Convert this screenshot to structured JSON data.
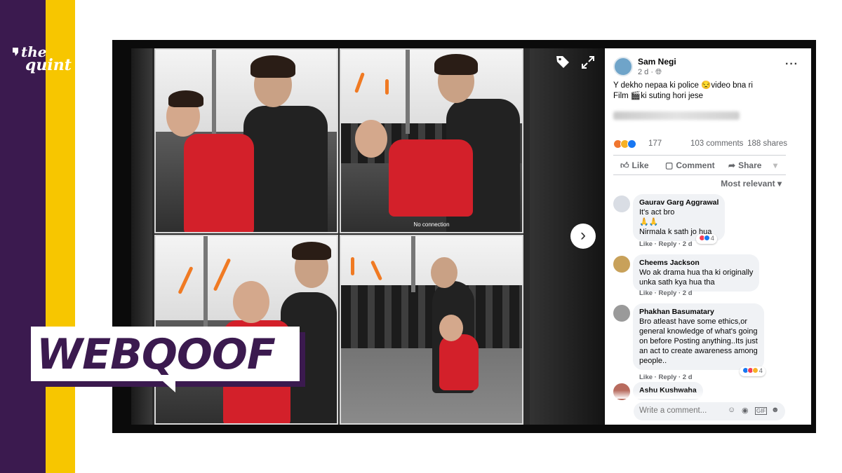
{
  "brand": {
    "logo_line1": "the",
    "logo_line2": "quint",
    "colors": {
      "purple": "#3b1a4f",
      "yellow": "#f7c600"
    }
  },
  "label": {
    "text": "WEBQOOF"
  },
  "photo": {
    "caption": "No connection",
    "icons": [
      "tag-icon",
      "expand-icon"
    ],
    "next_icon": "chevron-right-icon"
  },
  "post": {
    "author": "Sam Negi",
    "time": "2 d · ",
    "privacy_icon": "globe-icon",
    "text_line1": "Y dekho nepaa ki police 😒video bna ri",
    "text_line2": "Film 🎬ki suting hori jese",
    "reactions_count": "177",
    "comments": "103 comments",
    "shares": "188 shares",
    "actions": {
      "like": "Like",
      "comment": "Comment",
      "share": "Share"
    },
    "sort_label": "Most relevant ▾"
  },
  "comments": [
    {
      "author": "Gaurav Garg Aggrawal",
      "lines": [
        "It's act bro",
        "🙏🙏",
        "Nirmala k sath jo hua"
      ],
      "like": "Like",
      "reply": "Reply",
      "time": "2 d",
      "reaction_count": "4"
    },
    {
      "author": "Cheems Jackson",
      "lines": [
        "Wo ak drama hua tha ki originally",
        "unka sath kya hua tha"
      ],
      "like": "Like",
      "reply": "Reply",
      "time": "2 d"
    },
    {
      "author": "Phakhan Basumatary",
      "lines": [
        "Bro atleast have some ethics,or",
        "general knowledge of what's going",
        "on before Posting anything..Its just",
        "an act to create awareness among",
        "people.."
      ],
      "like": "Like",
      "reply": "Reply",
      "time": "2 d",
      "reaction_count": "4"
    },
    {
      "author": "Ashu Kushwaha"
    }
  ],
  "write_comment": {
    "placeholder": "Write a comment..."
  }
}
